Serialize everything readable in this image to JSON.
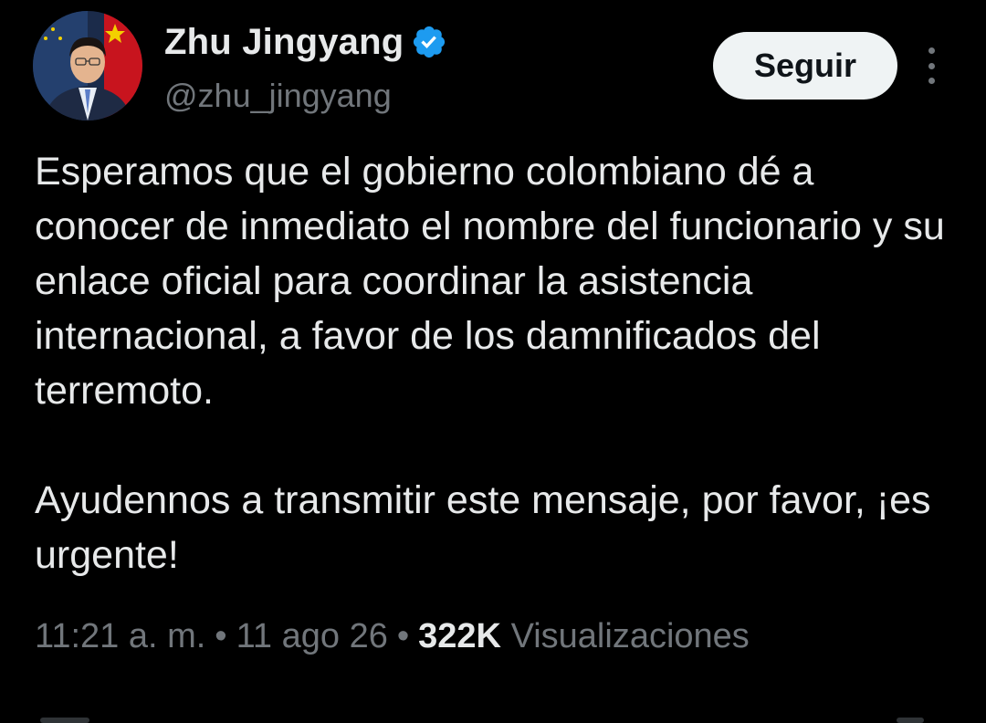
{
  "author": {
    "display_name": "Zhu Jingyang",
    "handle": "@zhu_jingyang",
    "verified_icon": "verified-badge-icon",
    "avatar_icon": "profile-photo"
  },
  "actions": {
    "follow_label": "Seguir",
    "more_icon": "more-vertical-icon"
  },
  "tweet": {
    "paragraphs": [
      "Esperamos que el gobierno colombiano dé a conocer de inmediato el nombre del funcionario y su enlace oficial para coordinar la asistencia internacional, a favor de los damnificados del terremoto.",
      "Ayudennos a transmitir este mensaje, por favor, ¡es urgente!"
    ]
  },
  "meta": {
    "time": "11:21 a. m.",
    "separator": "•",
    "date": "11 ago 26",
    "views_count": "322K",
    "views_label": "Visualizaciones"
  },
  "colors": {
    "background": "#000000",
    "text_primary": "#e7e9ea",
    "text_secondary": "#71767b",
    "verified_blue": "#1d9bf0",
    "button_bg": "#eff3f4"
  }
}
